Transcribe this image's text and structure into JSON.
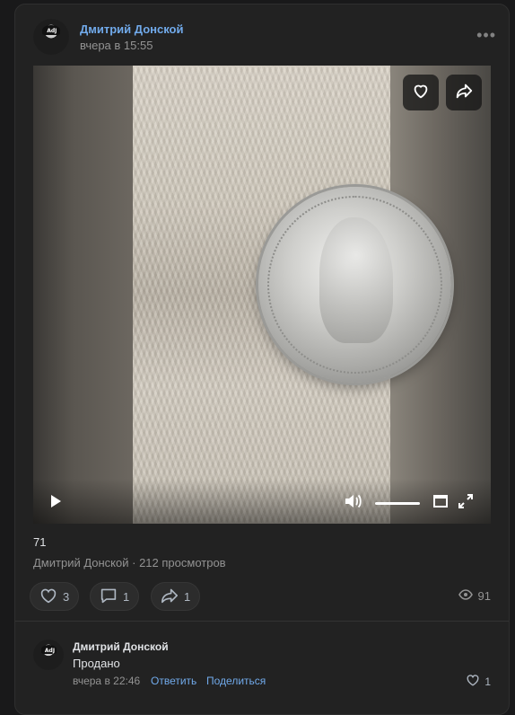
{
  "post": {
    "author": "Дмитрий Донской",
    "time": "вчера в 15:55",
    "more_label": "•••"
  },
  "video": {
    "title": "71",
    "channel": "Дмитрий Донской",
    "views": "212 просмотров",
    "volume_level": 1.0
  },
  "actions": {
    "likes": "3",
    "comments": "1",
    "shares": "1",
    "views": "91"
  },
  "comment": {
    "author": "Дмитрий Донской",
    "text": "Продано",
    "time": "вчера в 22:46",
    "reply_label": "Ответить",
    "share_label": "Поделиться",
    "likes": "1"
  },
  "colors": {
    "link": "#71aaeb",
    "background": "#19191a",
    "card": "#222222"
  }
}
